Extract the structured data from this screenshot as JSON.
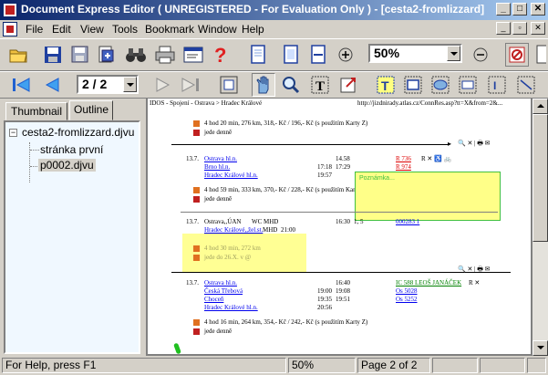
{
  "window": {
    "title": "Document Express Editor ( UNREGISTERED - For Evaluation Only ) - [cesta2-fromlizzard]"
  },
  "menu": [
    "File",
    "Edit",
    "View",
    "Tools",
    "Bookmark",
    "Window",
    "Help"
  ],
  "toolbar": {
    "zoom_value": "50%",
    "page_value": "2 / 2"
  },
  "sidebar": {
    "tabs": [
      "Thumbnail",
      "Outline"
    ],
    "active_tab": "Outline",
    "tree": {
      "root": "cesta2-fromlizzard.djvu",
      "children": [
        "stránka první",
        "p0002.djvu"
      ],
      "selected": "p0002.djvu"
    }
  },
  "page": {
    "header_left": "IDOS - Spojení - Ostrava > Hradec Králové",
    "header_right": "http://jizdnirady.atlas.cz/ConnRes.asp?tt=X&from=2&...",
    "block1": {
      "summary": "4 hod 20 min, 276 km, 318,- Kč / 196,- Kč (s použitím Karty Z)",
      "daily": "jede denně"
    },
    "block2": {
      "date": "13.7.",
      "rows": [
        {
          "station": "Ostrava hl.n.",
          "arr": "",
          "dep": "14.58",
          "train": "R 736"
        },
        {
          "station": "Brno hl.n.",
          "arr": "17:18",
          "dep": "17:29",
          "train": "R 974"
        },
        {
          "station": "Hradec Králové hl.n.",
          "arr": "19:57",
          "dep": "",
          "train": ""
        }
      ],
      "summary": "4 hod 59 min, 333 km, 370,- Kč / 228,- Kč (s použitím Karty Z)",
      "daily": "jede denně"
    },
    "block3": {
      "date": "13.7.",
      "rows": [
        {
          "station": "Ostrava,,ÚAN",
          "extra": "WC MHD",
          "arr": "",
          "dep": "16:30",
          "platform": "1, 5",
          "train": "000283 1"
        },
        {
          "station": "Hradec Králové,,žel.st.",
          "extra": "MHD",
          "arr": "21:00",
          "dep": "",
          "platform": "",
          "train": ""
        }
      ],
      "summary": "4 hod 30 min, 272 km",
      "note": "jede do 26.X. v @"
    },
    "block4": {
      "date": "13.7.",
      "rows": [
        {
          "station": "Ostrava hl.n.",
          "arr": "",
          "dep": "16:40",
          "train": "IC 588 LEOŠ JANÁČEK"
        },
        {
          "station": "Česká Třebová",
          "arr": "19:00",
          "dep": "19:08",
          "train": "Os 5028"
        },
        {
          "station": "Choceň",
          "arr": "19:35",
          "dep": "19:51",
          "train": "Os 5252"
        },
        {
          "station": "Hradec Králové hl.n.",
          "arr": "20:56",
          "dep": "",
          "train": ""
        }
      ],
      "summary": "4 hod 16 min, 264 km, 354,- Kč / 242,- Kč (s použitím Karty Z)",
      "daily": "jede denně"
    },
    "note_label": "Poznámka..."
  },
  "status": {
    "help": "For Help, press F1",
    "zoom": "50%",
    "page": "Page 2 of 2"
  },
  "colors": {
    "titlebar_start": "#0a246a",
    "titlebar_end": "#a6caf0",
    "annotation_yellow": "#ffff88",
    "link_blue": "#0000ee"
  }
}
